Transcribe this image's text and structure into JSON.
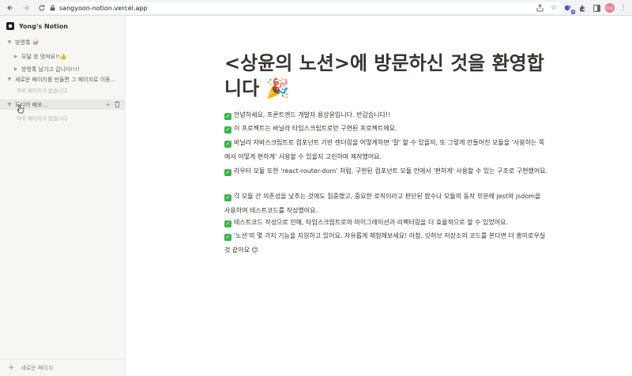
{
  "browser": {
    "url": "sangyoon-notion.vercel.app",
    "back_icon": "arrow-left",
    "forward_icon": "arrow-right",
    "reload_icon": "reload",
    "extension_badge": "2",
    "profile_initials": "상윤"
  },
  "sidebar": {
    "workspace_title": "Yong's Notion",
    "items": [
      {
        "label": "방명록 🥡"
      },
      {
        "label": "모달 창 멋져요!!👍"
      },
      {
        "label": "방명록 남기고 갑니다!!!!"
      },
      {
        "label": "새로운 페이지를 만들면 그 페이지로 이동..."
      },
      {
        "label": "하위 페이지가 없습니다."
      },
      {
        "label": "도디어 배포..."
      },
      {
        "label": "하위 페이지가 없습니다."
      }
    ],
    "new_page_label": "새로운 페이지"
  },
  "page": {
    "title_line1": "<상윤의 노션>에 방문하신 것을 환영합",
    "title_line2": "니다 🎉",
    "paragraphs": [
      "안녕하세요, 프론트엔드 개발자 용상윤입니다. 반갑습니다!!",
      "이 프로젝트는 바닐라 타입스크립트로만 구현된 프로젝트에요.",
      "바닐라 자바스크립트로 컴포넌트 기반 렌더링을 어떻게하면 '잘' 할 수 있을지, 또 그렇게 만들어진 모듈을 '사용하는 쪽에서 어떻게 편하게' 사용할 수 있을지 고민하며 제작했어요.",
      "라우터 모듈 또한 'react-router-dom' 처럼, 구현된 컴포넌트 모듈 안에서 '편하게' 사용할 수 있는 구조로 구현했어요.",
      "각 모듈 간 의존성을 낮추는 것에도 집중했고, 중요한 로직이라고 판단된 함수나 모듈의 동작 부분에 jest와 jsdom을 사용하여 테스트코드를 작성했어요.",
      "테스트코드 작성으로 인해, 타입스크립트로의 마이그레이션과 리팩터링을 더 효율적으로 할 수 있었어요.",
      "'노션'의 몇 가지 기능을 지원하고 있어요. 자유롭게 체험해보세요! 아참, 깃허브 저장소의 코드를 본다면 더 흥미로우실 것 같아요 😊"
    ]
  }
}
